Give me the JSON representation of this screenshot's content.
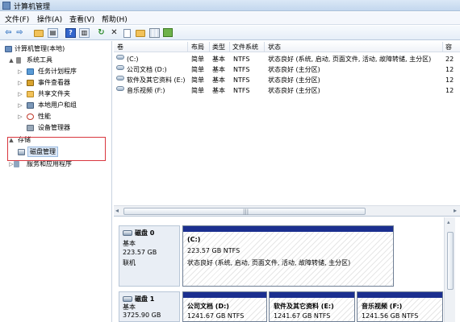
{
  "window": {
    "title": "计算机管理"
  },
  "menu": [
    "文件(F)",
    "操作(A)",
    "查看(V)",
    "帮助(H)"
  ],
  "toolbar": {
    "icons": [
      "back-icon",
      "forward-icon",
      "up-folder-icon",
      "show-hide-tree-icon",
      "help-icon",
      "properties-icon",
      "refresh-icon",
      "delete-icon",
      "folder-icon",
      "open-icon",
      "format-icon",
      "settings-icon"
    ]
  },
  "tree": {
    "root": "计算机管理(本地)",
    "items": [
      {
        "label": "系统工具",
        "expander": "▲"
      },
      {
        "label": "任务计划程序",
        "expander": "▷"
      },
      {
        "label": "事件查看器",
        "expander": "▷"
      },
      {
        "label": "共享文件夹",
        "expander": "▷"
      },
      {
        "label": "本地用户和组",
        "expander": "▷"
      },
      {
        "label": "性能",
        "expander": "▷"
      },
      {
        "label": "设备管理器",
        "expander": ""
      },
      {
        "label": "存储",
        "expander": "▲"
      },
      {
        "label": "磁盘管理",
        "expander": ""
      },
      {
        "label": "服务和应用程序",
        "expander": "▷"
      }
    ]
  },
  "volume_list": {
    "columns": [
      "卷",
      "布局",
      "类型",
      "文件系统",
      "状态",
      "容"
    ],
    "rows": [
      {
        "vol": "(C:)",
        "layout": "简单",
        "type": "基本",
        "fs": "NTFS",
        "status": "状态良好 (系统, 启动, 页面文件, 活动, 故障转储, 主分区)",
        "cap": "22"
      },
      {
        "vol": "公司文档 (D:)",
        "layout": "简单",
        "type": "基本",
        "fs": "NTFS",
        "status": "状态良好 (主分区)",
        "cap": "12"
      },
      {
        "vol": "软件及其它资料 (E:)",
        "layout": "简单",
        "type": "基本",
        "fs": "NTFS",
        "status": "状态良好 (主分区)",
        "cap": "12"
      },
      {
        "vol": "音乐视频 (F:)",
        "layout": "简单",
        "type": "基本",
        "fs": "NTFS",
        "status": "状态良好 (主分区)",
        "cap": "12"
      }
    ],
    "scroll_grip": "|||"
  },
  "disks": [
    {
      "name": "磁盘 0",
      "type": "基本",
      "size": "223.57 GB",
      "state": "联机",
      "partitions": [
        {
          "name": "(C:)",
          "size_fs": "223.57 GB NTFS",
          "status": "状态良好 (系统, 启动, 页面文件, 活动, 故障转储, 主分区)"
        }
      ]
    },
    {
      "name": "磁盘 1",
      "type": "基本",
      "size": "3725.90 GB",
      "partitions": [
        {
          "name": "公司文档  (D:)",
          "size_fs": "1241.67 GB NTFS"
        },
        {
          "name": "软件及其它资料  (E:)",
          "size_fs": "1241.67 GB NTFS"
        },
        {
          "name": "音乐视频  (F:)",
          "size_fs": "1241.56 GB NTFS"
        }
      ]
    }
  ]
}
